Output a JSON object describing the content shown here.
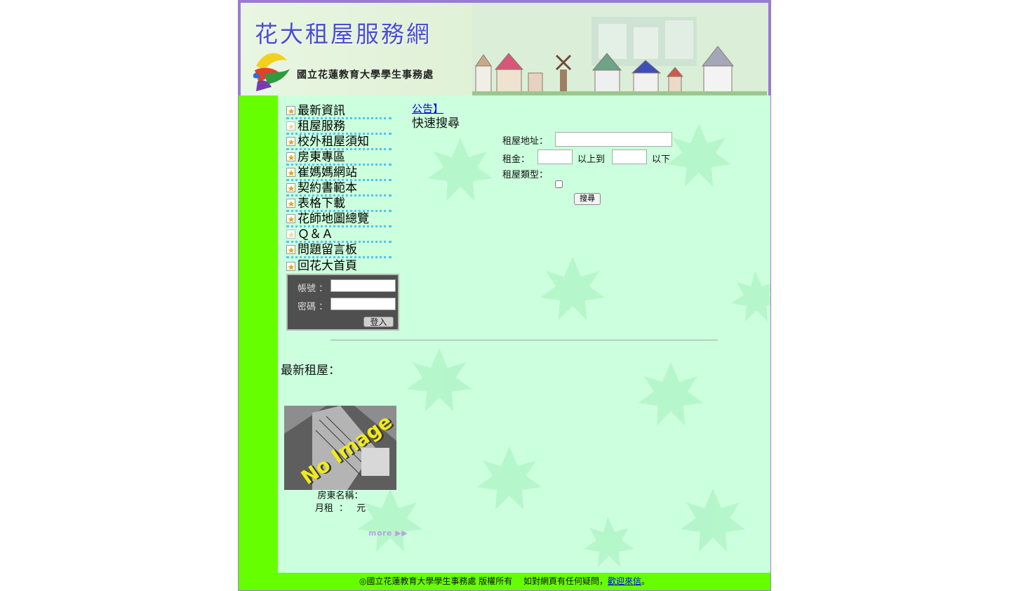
{
  "banner": {
    "title": "花大租屋服務網",
    "subtitle": "國立花蓮教育大學學生事務處"
  },
  "menu": {
    "items": [
      {
        "label": "最新資訊"
      },
      {
        "label": "租屋服務"
      },
      {
        "label": "校外租屋須知"
      },
      {
        "label": "房東專區"
      },
      {
        "label": "崔媽媽網站"
      },
      {
        "label": "契約書範本"
      },
      {
        "label": "表格下載"
      },
      {
        "label": "花師地圖總覽"
      },
      {
        "label": "Ｑ＆Ａ"
      },
      {
        "label": "問題留言板"
      },
      {
        "label": "回花大首頁"
      }
    ]
  },
  "login": {
    "account_label": "帳號 ：",
    "password_label": "密碼 ：",
    "account_value": "",
    "password_value": "",
    "submit_label": "登入"
  },
  "notice": {
    "link_text": "公告】"
  },
  "search": {
    "title": "快速搜尋",
    "address_label": "租屋地址：",
    "address_value": "",
    "rent_label": "租金：",
    "rent_min_value": "",
    "rent_mid_label": "以上到",
    "rent_max_value": "",
    "rent_end_label": "以下",
    "type_label": "租屋類型：",
    "submit_label": "搜尋"
  },
  "latest": {
    "title": "最新租屋：",
    "listing": {
      "image_text": "No Image",
      "landlord_label": "房東名稱：",
      "landlord_value": "",
      "rent_label": "月租",
      "rent_sep": "：",
      "rent_value": "",
      "rent_unit": "元"
    },
    "more_label": "more ▶▶"
  },
  "footer": {
    "copyright": "◎國立花蓮教育大學學生事務處 版權所有　 如對網頁有任何疑問，",
    "contact_link": "歡迎來信",
    "end": "。"
  },
  "colors": {
    "side_green": "#66ff00",
    "content_bg": "#ccffdd",
    "frame_purple": "#9b78d6",
    "menu_dots": "#4fc6f0"
  }
}
